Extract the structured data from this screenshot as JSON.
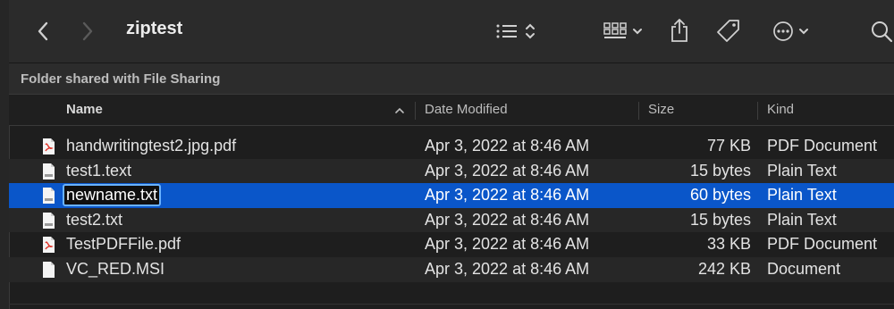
{
  "window": {
    "title": "ziptest",
    "info_bar": "Folder shared with File Sharing"
  },
  "columns": {
    "name": "Name",
    "date": "Date Modified",
    "size": "Size",
    "kind": "Kind"
  },
  "files": [
    {
      "name": "handwritingtest2.jpg.pdf",
      "date": "Apr 3, 2022 at 8:46 AM",
      "size": "77 KB",
      "kind": "PDF Document",
      "icon": "pdf-file-icon"
    },
    {
      "name": "test1.text",
      "date": "Apr 3, 2022 at 8:46 AM",
      "size": "15 bytes",
      "kind": "Plain Text",
      "icon": "text-file-icon"
    },
    {
      "name": "newname.txt",
      "date": "Apr 3, 2022 at 8:46 AM",
      "size": "60 bytes",
      "kind": "Plain Text",
      "icon": "text-file-icon"
    },
    {
      "name": "test2.txt",
      "date": "Apr 3, 2022 at 8:46 AM",
      "size": "15 bytes",
      "kind": "Plain Text",
      "icon": "text-file-icon"
    },
    {
      "name": "TestPDFFile.pdf",
      "date": "Apr 3, 2022 at 8:46 AM",
      "size": "33 KB",
      "kind": "PDF Document",
      "icon": "pdf-file-icon"
    },
    {
      "name": "VC_RED.MSI",
      "date": "Apr 3, 2022 at 8:46 AM",
      "size": "242 KB",
      "kind": "Document",
      "icon": "document-file-icon"
    }
  ],
  "selected_row": "newname.txt",
  "colors": {
    "selection": "#0a56c9",
    "rename_border": "#6ab2ff",
    "pdf_badge": "#e0342a"
  }
}
